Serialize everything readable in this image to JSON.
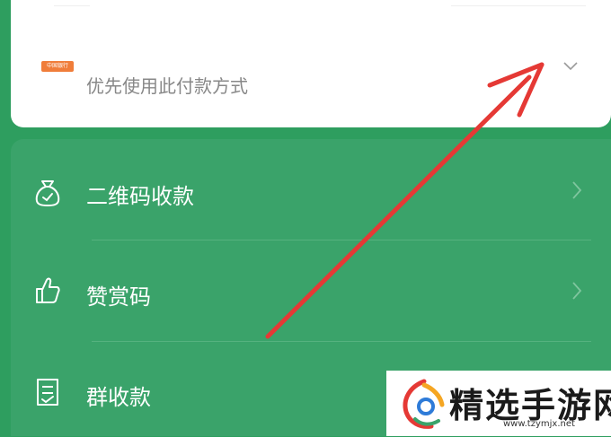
{
  "payment_card": {
    "bank_logo_text": "中国银行",
    "priority_text": "优先使用此付款方式",
    "expand_icon": "chevron-down-icon"
  },
  "menu": {
    "items": [
      {
        "label": "二维码收款",
        "icon": "money-bag-icon"
      },
      {
        "label": "赞赏码",
        "icon": "thumbs-up-icon"
      },
      {
        "label": "群收款",
        "icon": "receipt-icon"
      }
    ]
  },
  "annotation": {
    "arrow_color": "#e53935"
  },
  "watermark": {
    "name": "精选手游网",
    "url": "www.tzymjx.net"
  },
  "colors": {
    "background": "#2e9e5f",
    "panel": "#3aa36a",
    "card": "#ffffff"
  }
}
